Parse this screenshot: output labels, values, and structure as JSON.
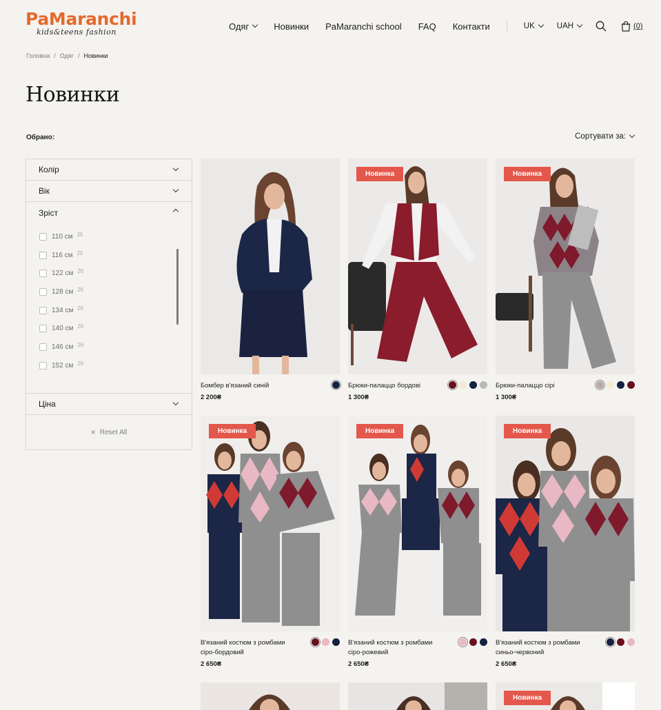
{
  "header": {
    "logo_main": "PaMaranchi",
    "logo_sub": "kids&teens fashion",
    "nav": [
      {
        "label": "Одяг",
        "dropdown": true
      },
      {
        "label": "Новинки",
        "dropdown": false
      },
      {
        "label": "PaMaranchi school",
        "dropdown": false
      },
      {
        "label": "FAQ",
        "dropdown": false
      },
      {
        "label": "Контакти",
        "dropdown": false
      }
    ],
    "language": "UK",
    "currency": "UAH",
    "cart_count": "(0)",
    "icons": {
      "search": "search-icon",
      "cart": "shopping-bag-icon"
    }
  },
  "breadcrumb": [
    "Головна",
    "Одяг",
    "Новинки"
  ],
  "page_title": "Новинки",
  "selected_label": "Обрано:",
  "sort_label": "Сортувати за:",
  "filters": {
    "color": "Колір",
    "age": "Вік",
    "height": "Зріст",
    "height_options": [
      {
        "label": "110 см",
        "count": "25"
      },
      {
        "label": "116 см",
        "count": "25"
      },
      {
        "label": "122 см",
        "count": "26"
      },
      {
        "label": "128 см",
        "count": "26"
      },
      {
        "label": "134 см",
        "count": "26"
      },
      {
        "label": "140 см",
        "count": "26"
      },
      {
        "label": "146 см",
        "count": "26"
      },
      {
        "label": "152 см",
        "count": "26"
      }
    ],
    "price": "Ціна",
    "reset": "Reset All"
  },
  "badge_label": "Новинка",
  "products": [
    {
      "name": "Бомбер в'язаний синій",
      "price": "2 200₴",
      "badge": false,
      "colors": [
        "#14213f"
      ]
    },
    {
      "name": "Брюки-палаццо бордові",
      "price": "1 300₴",
      "badge": true,
      "colors": [
        "#6b0f1f",
        "#f0ebd2",
        "#14213f",
        "#b9b9b9"
      ]
    },
    {
      "name": "Брюки-палаццо сірі",
      "price": "1 300₴",
      "badge": true,
      "colors": [
        "#b7a9a3",
        "#f0ebd2",
        "#14213f",
        "#6b0f1f"
      ]
    },
    {
      "name": "В'язаний костюм з ромбами сіро-бордовий",
      "price": "2 650₴",
      "badge": true,
      "colors": [
        "#6b0f1f",
        "#e8b8c4",
        "#14213f"
      ]
    },
    {
      "name": "В'язаний костюм з ромбами сіро-рожевий",
      "price": "2 650₴",
      "badge": true,
      "colors": [
        "#e8b8c4",
        "#6b0f1f",
        "#14213f"
      ]
    },
    {
      "name": "В'язаний костюм з ромбами синьо-червоний",
      "price": "2 650₴",
      "badge": true,
      "colors": [
        "#14213f",
        "#6b0f1f",
        "#e8b8c4"
      ]
    }
  ],
  "bottom_row_badges": [
    false,
    false,
    true
  ]
}
